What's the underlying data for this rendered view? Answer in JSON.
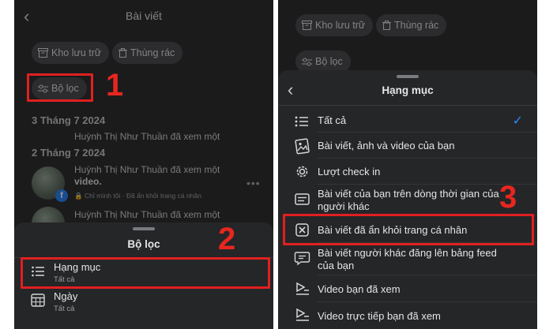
{
  "left": {
    "title": "Bài viết",
    "chips": {
      "archive": "Kho lưu trữ",
      "trash": "Thùng rác",
      "filter": "Bộ lọc"
    },
    "date1": "3 Tháng 7 2024",
    "post1_text": "Huỳnh Thị Như Thuần đã xem một",
    "date2": "2 Tháng 7 2024",
    "post2": {
      "line1": "Huỳnh Thị Như Thuần đã xem một",
      "line2": "video.",
      "meta": "Chỉ mình tôi · Đã ẩn khỏi trang cá nhân"
    },
    "post3_text": "Huỳnh Thị Như Thuần đã xem một",
    "sheet": {
      "title": "Bộ lọc",
      "options": [
        {
          "label": "Hạng mục",
          "sub": "Tất cả"
        },
        {
          "label": "Ngày",
          "sub": "Tất cả"
        }
      ]
    },
    "step1": "1",
    "step2": "2"
  },
  "right": {
    "chips": {
      "archive": "Kho lưu trữ",
      "trash": "Thùng rác",
      "filter": "Bộ lọc"
    },
    "sheet_title": "Hạng mục",
    "items": [
      {
        "label": "Tất cả",
        "icon": "list-icon",
        "selected": true
      },
      {
        "label": "Bài viết, ảnh và video của bạn",
        "icon": "photo-icon"
      },
      {
        "label": "Lượt check in",
        "icon": "checkin-icon"
      },
      {
        "label": "Bài viết của bạn trên dòng thời gian của người khác",
        "icon": "timeline-post-icon"
      },
      {
        "label": "Bài viết đã ẩn khỏi trang cá nhân",
        "icon": "hidden-x-icon"
      },
      {
        "label": "Bài viết người khác đăng lên bảng feed của bạn",
        "icon": "feed-post-icon"
      },
      {
        "label": "Video bạn đã xem",
        "icon": "video-watched-icon"
      },
      {
        "label": "Video trực tiếp bạn đã xem",
        "icon": "live-video-icon"
      }
    ],
    "step3": "3"
  },
  "colors": {
    "panel_bg": "#1b1b1c",
    "sheet_bg": "#252628",
    "highlight": "#e02020",
    "check": "#2d88ff"
  }
}
